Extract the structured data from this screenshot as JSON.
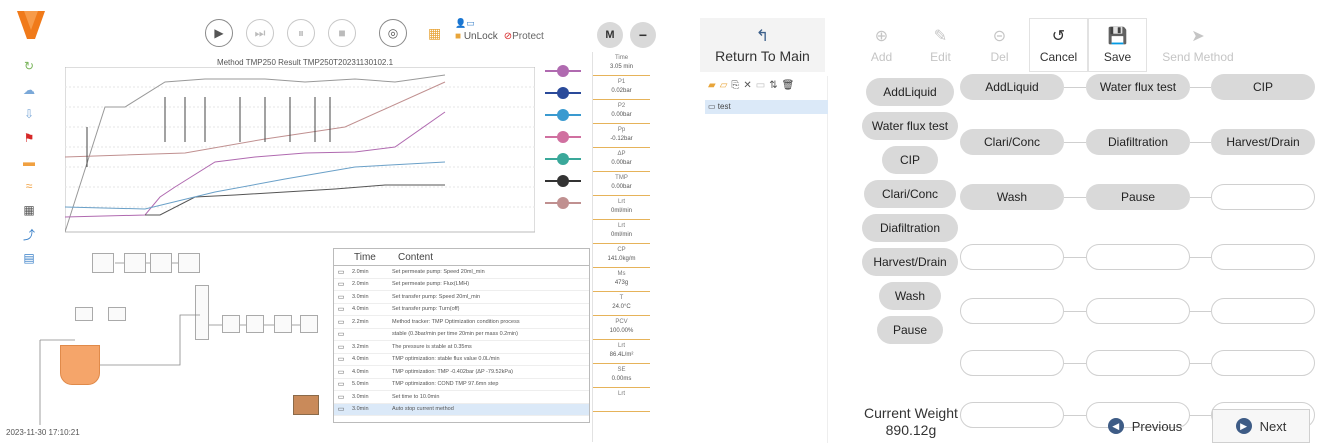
{
  "colors": {
    "brand": "#f07a1a",
    "accent": "#3e5c86",
    "pill": "#d9d9d9",
    "selection": "#dbe9f8"
  },
  "top": {
    "avatar": "M",
    "unlock": "UnLock",
    "protect": "Protect",
    "toolbar_icons": [
      "play-icon",
      "step-icon",
      "pause-icon",
      "stop-icon",
      "target-icon",
      "report-icon",
      "user-icon"
    ]
  },
  "chart": {
    "title": "Method TMP250 Result TMP250T20231130102.1"
  },
  "readings": [
    {
      "k": "Time",
      "v": "3.05 min"
    },
    {
      "k": "P1",
      "v": "0.02bar"
    },
    {
      "k": "P2",
      "v": "0.00bar"
    },
    {
      "k": "Pp",
      "v": "-0.12bar"
    },
    {
      "k": "ΔP",
      "v": "0.00bar"
    },
    {
      "k": "TMP",
      "v": "0.00bar"
    },
    {
      "k": "Lrt",
      "v": "0ml/min"
    },
    {
      "k": "Lrt",
      "v": "0ml/min"
    },
    {
      "k": "CP",
      "v": "141.0kg/m"
    },
    {
      "k": "Ms",
      "v": "473g"
    },
    {
      "k": "T",
      "v": "24.0°C"
    },
    {
      "k": "PCV",
      "v": "100.00%"
    },
    {
      "k": "Lrt",
      "v": "86.4L/m²"
    },
    {
      "k": "SE",
      "v": "0.00ms"
    },
    {
      "k": "Lrt",
      "v": ""
    }
  ],
  "log": {
    "col_time": "Time",
    "col_content": "Content",
    "rows": [
      {
        "t": "2.0min",
        "m": "Set permeate pump: Speed 20ml_min"
      },
      {
        "t": "2.0min",
        "m": "Set permeate pump: Flux(LMH)"
      },
      {
        "t": "3.0min",
        "m": "Set transfer pump: Speed 20ml_min"
      },
      {
        "t": "4.0min",
        "m": "Set transfer pump: Turn(off)"
      },
      {
        "t": "2.2min",
        "m": "Method tracker: TMP Optimization condition process"
      },
      {
        "t": "",
        "m": "stable (0.3bar/min per time 20min per mass 0.2min)"
      },
      {
        "t": "3.2min",
        "m": "The pressure is stable at 0.35ms"
      },
      {
        "t": "4.0min",
        "m": "TMP optimization: stable flux value 0.0L/min"
      },
      {
        "t": "4.0min",
        "m": "TMP optimization: TMP -0.402bar (ΔP -79.52kPa)"
      },
      {
        "t": "5.0min",
        "m": "TMP optimization: COND TMP 97.6mn step"
      },
      {
        "t": "3.0min",
        "m": "Set time to 10.0min"
      },
      {
        "t": "3.0min",
        "m": "Auto stop current method"
      }
    ]
  },
  "timestamp": "2023-11-30 17:10:21",
  "right": {
    "return_main": "Return To Main",
    "toolbar": [
      {
        "label": "Add",
        "icon": "add-icon",
        "enabled": false
      },
      {
        "label": "Edit",
        "icon": "edit-icon",
        "enabled": false
      },
      {
        "label": "Del",
        "icon": "delete-icon",
        "enabled": false
      },
      {
        "label": "Cancel",
        "icon": "cancel-icon",
        "enabled": true
      },
      {
        "label": "Save",
        "icon": "save-icon",
        "enabled": true
      },
      {
        "label": "Send Method",
        "icon": "send-icon",
        "enabled": false
      }
    ],
    "tree_node": "test",
    "steps": [
      "AddLiquid",
      "Water flux test",
      "CIP",
      "Clari/Conc",
      "Diafiltration",
      "Harvest/Drain",
      "Wash",
      "Pause"
    ],
    "sequence": [
      "AddLiquid",
      "Water flux test",
      "CIP",
      "Clari/Conc",
      "Diafiltration",
      "Harvest/Drain",
      "Wash",
      "Pause"
    ],
    "current_weight_label": "Current Weight",
    "current_weight_value": "890.12g",
    "previous": "Previous",
    "next": "Next"
  }
}
